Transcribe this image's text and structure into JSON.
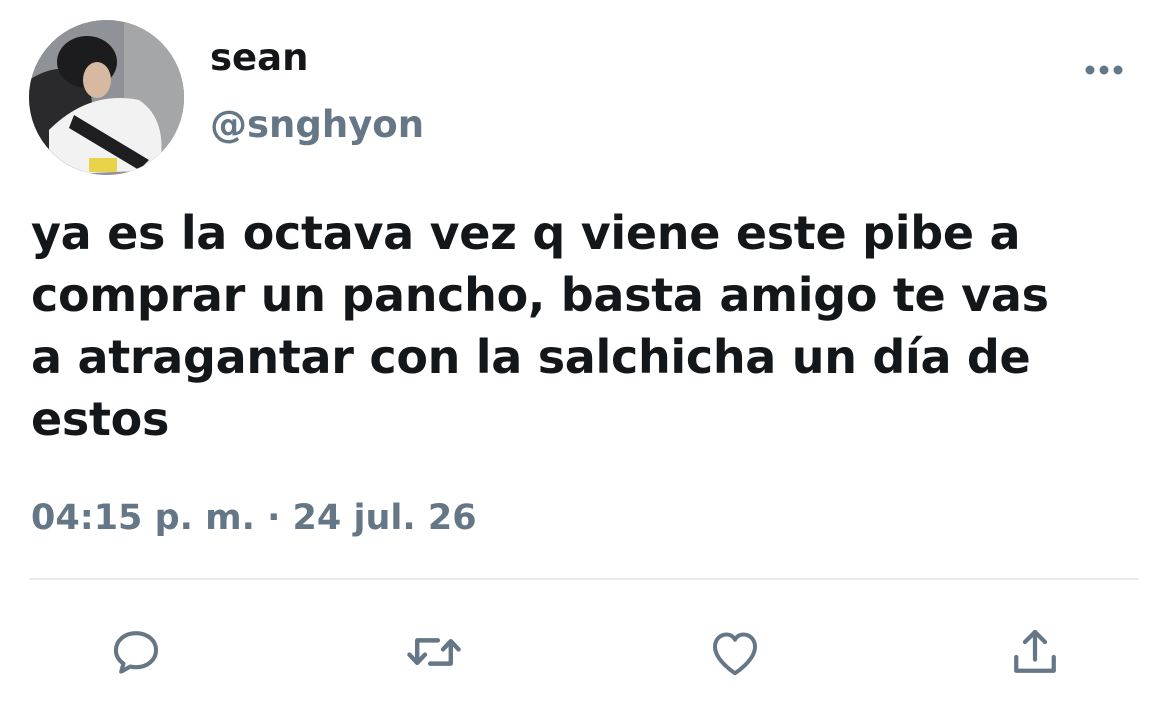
{
  "user": {
    "display_name": "sean",
    "handle": "@snghyon"
  },
  "tweet": {
    "lines": [
      "ya es la octava vez q viene este pibe a",
      "comprar un pancho, basta amigo te vas",
      "a atragantar con la salchicha un día de",
      "estos"
    ],
    "timestamp": "04:15 p. m. · 24 jul. 26"
  },
  "icons": {
    "more": "more-horizontal-icon",
    "reply": "reply-icon",
    "retweet": "retweet-icon",
    "like": "heart-icon",
    "share": "share-icon"
  },
  "colors": {
    "text": "#14171a",
    "secondary": "#657786",
    "divider": "#e6ecf0"
  }
}
